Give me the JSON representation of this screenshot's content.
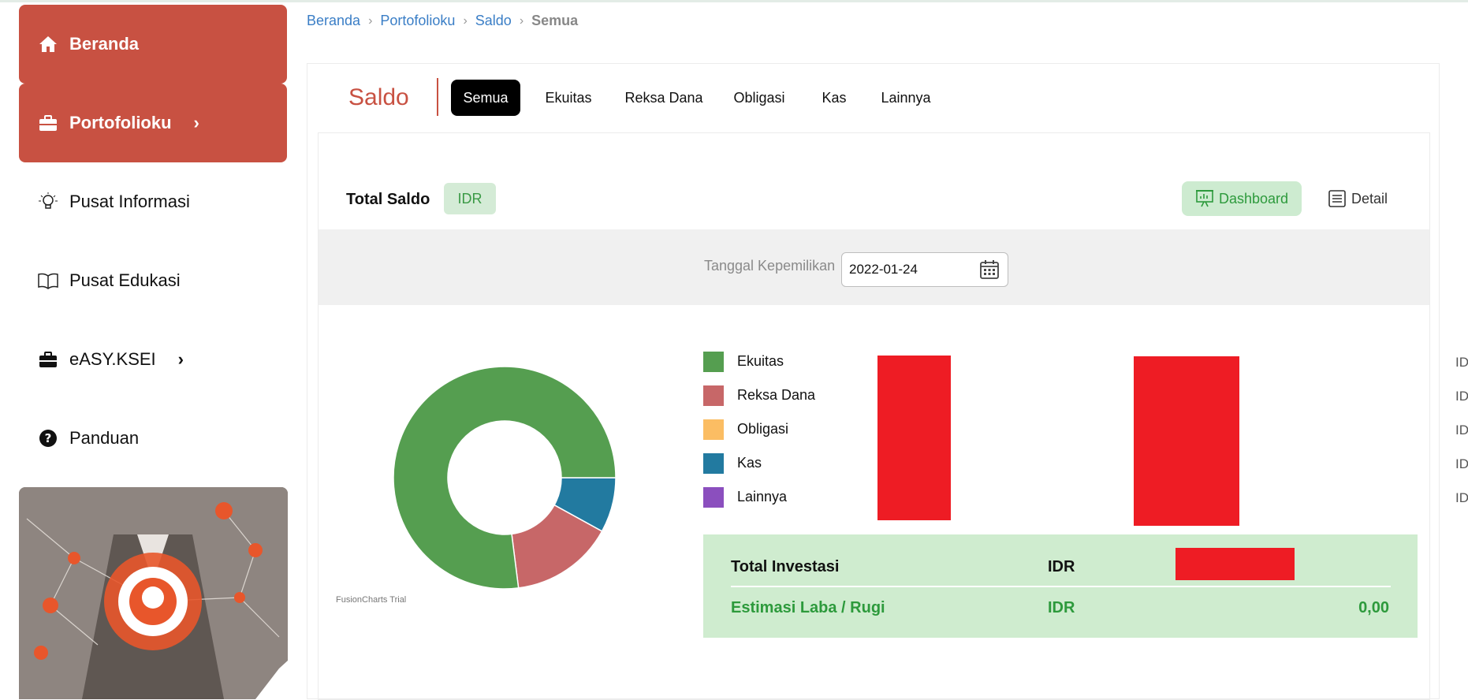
{
  "sidebar": {
    "items": [
      {
        "label": "Beranda",
        "icon": "home-icon",
        "active": true
      },
      {
        "label": "Portofolioku",
        "icon": "briefcase-icon",
        "active": true
      },
      {
        "label": "Pusat Informasi",
        "icon": "lightbulb-icon",
        "active": false
      },
      {
        "label": "Pusat Edukasi",
        "icon": "book-icon",
        "active": false
      },
      {
        "label": "eASY.KSEI",
        "icon": "briefcase-icon",
        "active": false
      },
      {
        "label": "Panduan",
        "icon": "question-circle-icon",
        "active": false
      }
    ]
  },
  "breadcrumb": [
    "Beranda",
    "Portofolioku",
    "Saldo",
    "Semua"
  ],
  "header": {
    "title": "Saldo",
    "tabs": [
      "Semua",
      "Ekuitas",
      "Reksa Dana",
      "Obligasi",
      "Kas",
      "Lainnya"
    ],
    "active_tab": "Semua"
  },
  "totals": {
    "label": "Total Saldo",
    "currency": "IDR",
    "dashboard_label": "Dashboard",
    "detail_label": "Detail"
  },
  "filter": {
    "label": "Tanggal Kepemilikan",
    "date": "2022-01-24"
  },
  "chart_data": {
    "type": "pie",
    "categories": [
      "Ekuitas",
      "Reksa Dana",
      "Kas"
    ],
    "values": [
      77,
      15,
      8
    ],
    "colors": [
      "#559e50",
      "#c76768",
      "#227aa0"
    ],
    "watermark": "FusionCharts Trial"
  },
  "legend": [
    {
      "label": "Ekuitas",
      "color": "#559e50",
      "currency": "IDR"
    },
    {
      "label": "Reksa Dana",
      "color": "#c76768",
      "currency": "IDR"
    },
    {
      "label": "Obligasi",
      "color": "#fbbd63",
      "currency": "IDR"
    },
    {
      "label": "Kas",
      "color": "#227aa0",
      "currency": "IDR"
    },
    {
      "label": "Lainnya",
      "color": "#8b4fbe",
      "currency": "IDR"
    }
  ],
  "summary": {
    "total_label": "Total Investasi",
    "total_currency": "IDR",
    "pl_label": "Estimasi Laba / Rugi",
    "pl_currency": "IDR",
    "pl_value": "0,00"
  },
  "colors": {
    "accent": "#c85142",
    "green": "#2d9a3c",
    "redaction": "#ee1c24"
  }
}
